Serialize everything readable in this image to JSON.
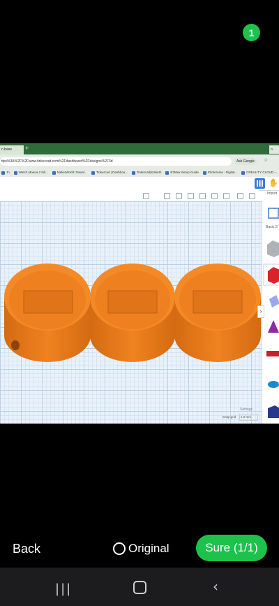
{
  "selection_count": "1",
  "browser": {
    "active_tab": "n base",
    "new_tab": "+",
    "right_tab": "o",
    "address": "ttps%3A%2F%2Fwww.tinkercad.com%2Fdashboard%2Fdesigns%2F3d",
    "ask_google": "Ask Google",
    "bookmarks": [
      "Jn",
      "Watch Moana 2 full...",
      "MakerWorld: Downl...",
      "Tinkercad | Dashboa...",
      "Tinkercad|Izabeth",
      "R3Max Setup Guide",
      "Printernme - Digital...",
      "CREALITY CLOUD -..."
    ]
  },
  "tinkercad": {
    "import_label": "Import",
    "panel_title": "Basic S",
    "settings_label": "Settings",
    "snap_label": "Snap grid",
    "snap_value": "1.0 mm"
  },
  "bottom_bar": {
    "back_label": "Back",
    "original_label": "Original",
    "sure_label": "Sure (1/1)"
  },
  "colors": {
    "accent_green": "#1ec14b",
    "model_orange": "#f07e1e"
  }
}
